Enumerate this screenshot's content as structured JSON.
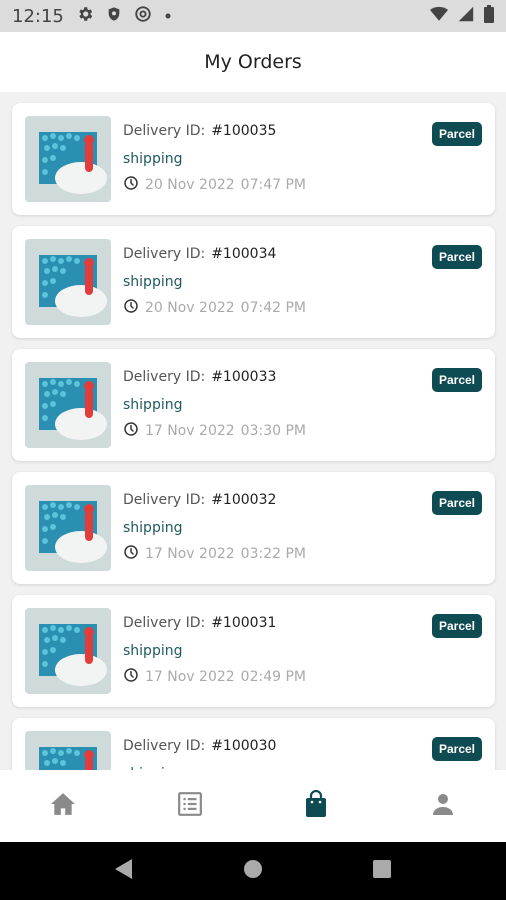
{
  "status_bar": {
    "time": "12:15",
    "icons": [
      "settings-gear-icon",
      "shield-icon",
      "at-sign-icon",
      "dot-icon",
      "wifi-icon",
      "signal-icon",
      "battery-icon"
    ]
  },
  "app": {
    "title": "My Orders"
  },
  "orders": [
    {
      "delivery_label": "Delivery ID:",
      "delivery_id": "#100035",
      "status": "shipping",
      "date": "20 Nov 2022",
      "time": "07:47 PM",
      "type": "Parcel"
    },
    {
      "delivery_label": "Delivery ID:",
      "delivery_id": "#100034",
      "status": "shipping",
      "date": "20 Nov 2022",
      "time": "07:42 PM",
      "type": "Parcel"
    },
    {
      "delivery_label": "Delivery ID:",
      "delivery_id": "#100033",
      "status": "shipping",
      "date": "17 Nov 2022",
      "time": "03:30 PM",
      "type": "Parcel"
    },
    {
      "delivery_label": "Delivery ID:",
      "delivery_id": "#100032",
      "status": "shipping",
      "date": "17 Nov 2022",
      "time": "03:22 PM",
      "type": "Parcel"
    },
    {
      "delivery_label": "Delivery ID:",
      "delivery_id": "#100031",
      "status": "shipping",
      "date": "17 Nov 2022",
      "time": "02:49 PM",
      "type": "Parcel"
    },
    {
      "delivery_label": "Delivery ID:",
      "delivery_id": "#100030",
      "status": "shipping",
      "date": "",
      "time": "",
      "type": "Parcel"
    }
  ],
  "bottom_nav": [
    {
      "icon": "home-icon",
      "active": false
    },
    {
      "icon": "list-icon",
      "active": false
    },
    {
      "icon": "shopping-bag-icon",
      "active": true
    },
    {
      "icon": "person-icon",
      "active": false
    }
  ],
  "colors": {
    "accent": "#0f4b52",
    "status_text": "#1f5a5e",
    "inactive_icon": "#8a8a8a"
  }
}
